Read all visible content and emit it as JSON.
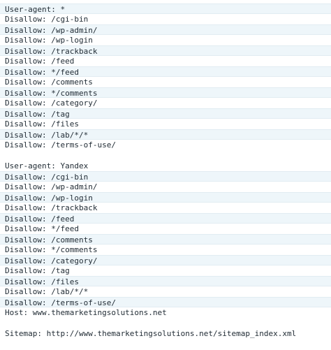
{
  "robots_txt": {
    "lines": [
      "User-agent: *",
      "Disallow: /cgi-bin",
      "Disallow: /wp-admin/",
      "Disallow: /wp-login",
      "Disallow: /trackback",
      "Disallow: /feed",
      "Disallow: */feed",
      "Disallow: /comments",
      "Disallow: */comments",
      "Disallow: /category/",
      "Disallow: /tag",
      "Disallow: /files",
      "Disallow: /lab/*/*",
      "Disallow: /terms-of-use/",
      "",
      "User-agent: Yandex",
      "Disallow: /cgi-bin",
      "Disallow: /wp-admin/",
      "Disallow: /wp-login",
      "Disallow: /trackback",
      "Disallow: /feed",
      "Disallow: */feed",
      "Disallow: /comments",
      "Disallow: */comments",
      "Disallow: /category/",
      "Disallow: /tag",
      "Disallow: /files",
      "Disallow: /lab/*/*",
      "Disallow: /terms-of-use/",
      "Host: www.themarketingsolutions.net",
      "",
      "Sitemap: http://www.themarketingsolutions.net/sitemap_index.xml"
    ]
  }
}
